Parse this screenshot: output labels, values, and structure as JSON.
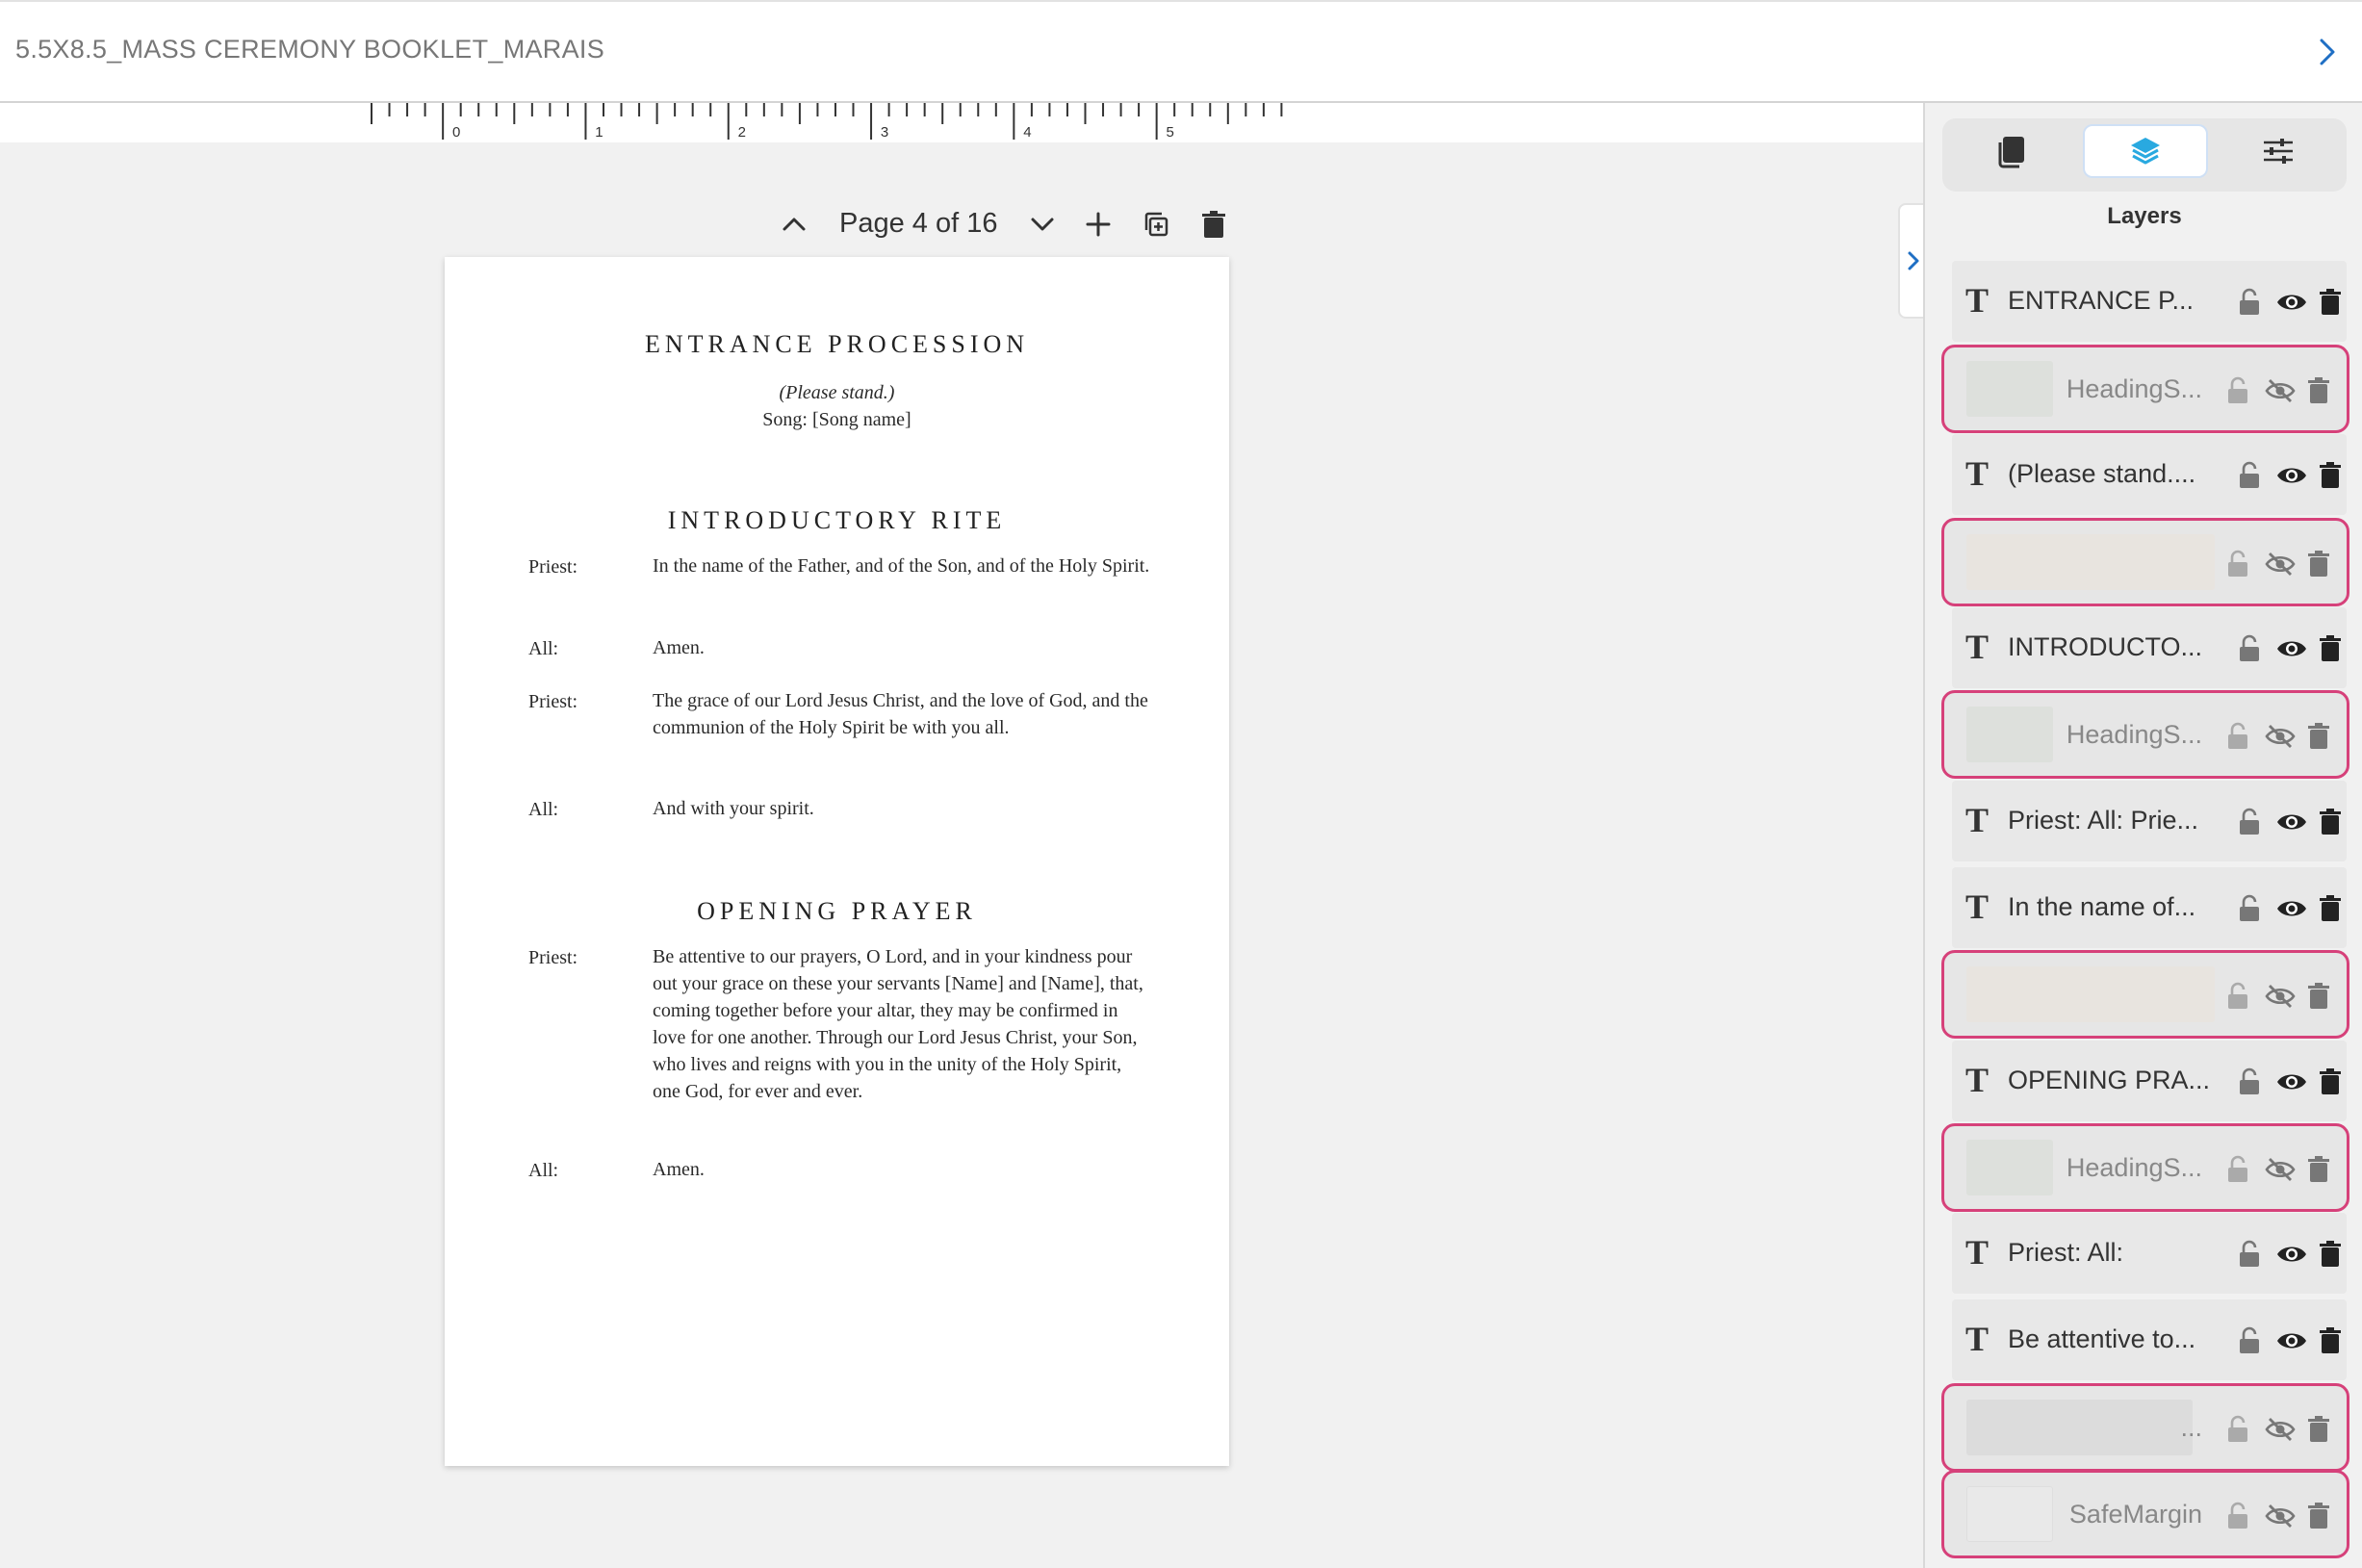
{
  "document": {
    "title": "5.5X8.5_MASS CEREMONY BOOKLET_MARAIS"
  },
  "ruler": {
    "labels": [
      "0",
      "1",
      "2",
      "3",
      "4",
      "5"
    ]
  },
  "page_toolbar": {
    "page_label": "Page 4 of 16"
  },
  "page": {
    "sections": [
      {
        "heading": "ENTRANCE PROCESSION",
        "subtitle": "(Please stand.)",
        "song": "Song: [Song name]"
      },
      {
        "heading": "INTRODUCTORY RITE"
      },
      {
        "heading": "OPENING PRAYER"
      }
    ],
    "lines": [
      {
        "speaker": "Priest:",
        "text": "In the name of the Father, and of the Son, and of the Holy Spirit."
      },
      {
        "speaker": "All:",
        "text": "Amen."
      },
      {
        "speaker": "Priest:",
        "text": "The grace of our Lord Jesus Christ, and the love of God, and the communion of the Holy Spirit be with you all."
      },
      {
        "speaker": "All:",
        "text": "And with your spirit."
      },
      {
        "speaker": "Priest:",
        "text": "Be attentive to our prayers, O Lord, and in your kindness pour out your grace on these your servants [Name] and [Name], that, coming together before your altar, they may be confirmed in love for one another. Through our Lord Jesus Christ, your Son, who lives and reigns with you in the unity of the Holy Spirit, one God, for ever and ever."
      },
      {
        "speaker": "All:",
        "text": "Amen."
      }
    ]
  },
  "panel": {
    "tabs": [
      {
        "icon": "pages-icon"
      },
      {
        "icon": "layers-icon",
        "active": true
      },
      {
        "icon": "settings-sliders-icon"
      }
    ],
    "title": "Layers",
    "layers": [
      {
        "type": "text",
        "name": "ENTRANCE P...",
        "visible": true
      },
      {
        "type": "image",
        "name": "HeadingS...",
        "visible": false
      },
      {
        "type": "text",
        "name": "(Please stand....",
        "visible": true
      },
      {
        "type": "image",
        "name": "",
        "visible": false
      },
      {
        "type": "text",
        "name": "INTRODUCTO...",
        "visible": true
      },
      {
        "type": "image",
        "name": "HeadingS...",
        "visible": false
      },
      {
        "type": "text",
        "name": "Priest: All: Prie...",
        "visible": true
      },
      {
        "type": "text",
        "name": "In the name of...",
        "visible": true
      },
      {
        "type": "image",
        "name": "",
        "visible": false
      },
      {
        "type": "text",
        "name": "OPENING PRA...",
        "visible": true
      },
      {
        "type": "image",
        "name": "HeadingS...",
        "visible": false
      },
      {
        "type": "text",
        "name": "Priest: All:",
        "visible": true
      },
      {
        "type": "text",
        "name": "Be attentive to...",
        "visible": true
      },
      {
        "type": "image",
        "name": "...",
        "visible": false
      },
      {
        "type": "image",
        "name": "SafeMargin",
        "visible": false
      }
    ]
  },
  "colors": {
    "accent": "#29a9e0",
    "highlight_border": "#d6417a",
    "chevron_blue": "#1f6fc4"
  }
}
